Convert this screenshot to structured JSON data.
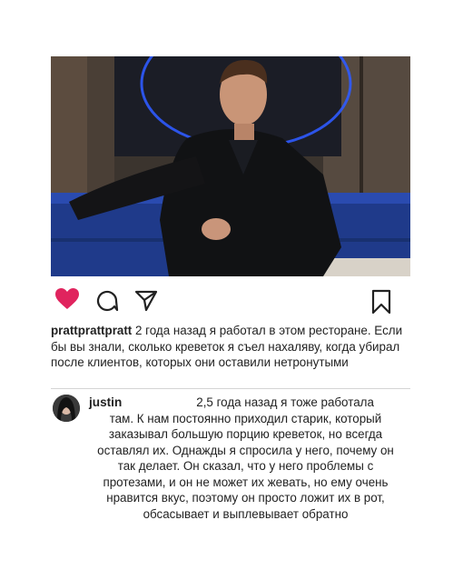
{
  "post": {
    "image_alt": "man in black leather jacket sitting in a blue booth with neon sign behind",
    "username": "prattprattpratt",
    "caption": "2 года назад я работал в этом ресторане. Если бы вы знали, сколько креветок я съел нахаляву, когда убирал после клиентов, которых они оставили нетронутыми"
  },
  "actions": {
    "like_icon": "heart-icon-filled",
    "comment_icon": "comment-icon",
    "share_icon": "send-icon",
    "save_icon": "bookmark-icon",
    "like_color": "#e0245e"
  },
  "comment": {
    "username": "justin",
    "first_line": "2,5 года назад я тоже работала",
    "body": "там. К нам постоянно приходил старик, который заказывал большую порцию креветок, но всегда оставлял их. Однажды я спросила у него, почему он так делает. Он сказал, что у него проблемы с протезами, и он не может их жевать, но ему очень нравится вкус, поэтому он просто ложит их в рот, обсасывает и выплевывает обратно"
  }
}
